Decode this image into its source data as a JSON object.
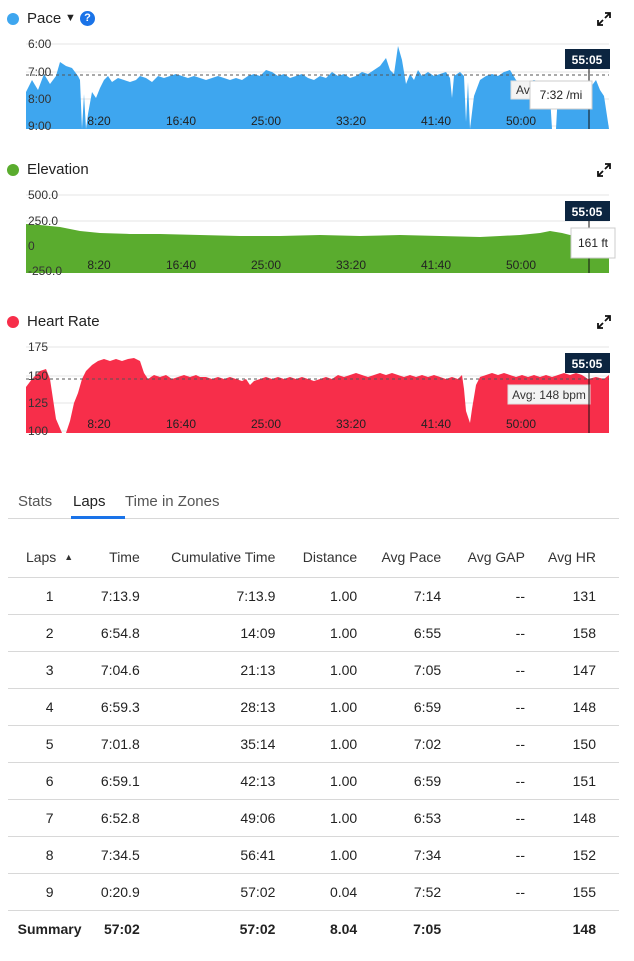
{
  "charts": {
    "pace": {
      "title": "Pace",
      "color": "#3ea6ef",
      "icons": [
        "chevron-down-icon",
        "help-icon",
        "expand-icon"
      ],
      "help_glyph": "?",
      "y_ticks": [
        "6:00",
        "7:00",
        "8:00",
        "9:00"
      ],
      "x_ticks": [
        "8:20",
        "16:40",
        "25:00",
        "33:20",
        "41:40",
        "50:00"
      ],
      "cursor_time": "55:05",
      "tooltip": "7:32 /mi",
      "avg_label_partial": "Avg"
    },
    "elevation": {
      "title": "Elevation",
      "color": "#5aac2e",
      "icons": [
        "expand-icon"
      ],
      "y_ticks": [
        "500.0",
        "250.0",
        "0",
        "-250.0"
      ],
      "x_ticks": [
        "8:20",
        "16:40",
        "25:00",
        "33:20",
        "41:40",
        "50:00"
      ],
      "cursor_time": "55:05",
      "tooltip": "161 ft"
    },
    "heart_rate": {
      "title": "Heart Rate",
      "color": "#f72e4a",
      "icons": [
        "expand-icon"
      ],
      "y_ticks": [
        "175",
        "150",
        "125",
        "100"
      ],
      "x_ticks": [
        "8:20",
        "16:40",
        "25:00",
        "33:20",
        "41:40",
        "50:00"
      ],
      "cursor_time": "55:05",
      "avg_label": "Avg: 148 bpm"
    }
  },
  "tabs": [
    "Stats",
    "Laps",
    "Time in Zones"
  ],
  "active_tab": "Laps",
  "laps_table": {
    "sort_glyph": "▲",
    "headers": [
      "Laps",
      "Time",
      "Cumulative Time",
      "Distance",
      "Avg Pace",
      "Avg GAP",
      "Avg HR"
    ],
    "rows": [
      [
        "1",
        "7:13.9",
        "7:13.9",
        "1.00",
        "7:14",
        "--",
        "131"
      ],
      [
        "2",
        "6:54.8",
        "14:09",
        "1.00",
        "6:55",
        "--",
        "158"
      ],
      [
        "3",
        "7:04.6",
        "21:13",
        "1.00",
        "7:05",
        "--",
        "147"
      ],
      [
        "4",
        "6:59.3",
        "28:13",
        "1.00",
        "6:59",
        "--",
        "148"
      ],
      [
        "5",
        "7:01.8",
        "35:14",
        "1.00",
        "7:02",
        "--",
        "150"
      ],
      [
        "6",
        "6:59.1",
        "42:13",
        "1.00",
        "6:59",
        "--",
        "151"
      ],
      [
        "7",
        "6:52.8",
        "49:06",
        "1.00",
        "6:53",
        "--",
        "148"
      ],
      [
        "8",
        "7:34.5",
        "56:41",
        "1.00",
        "7:34",
        "--",
        "152"
      ],
      [
        "9",
        "0:20.9",
        "57:02",
        "0.04",
        "7:52",
        "--",
        "155"
      ]
    ],
    "summary": [
      "Summary",
      "57:02",
      "57:02",
      "8.04",
      "7:05",
      "",
      "148"
    ]
  }
}
